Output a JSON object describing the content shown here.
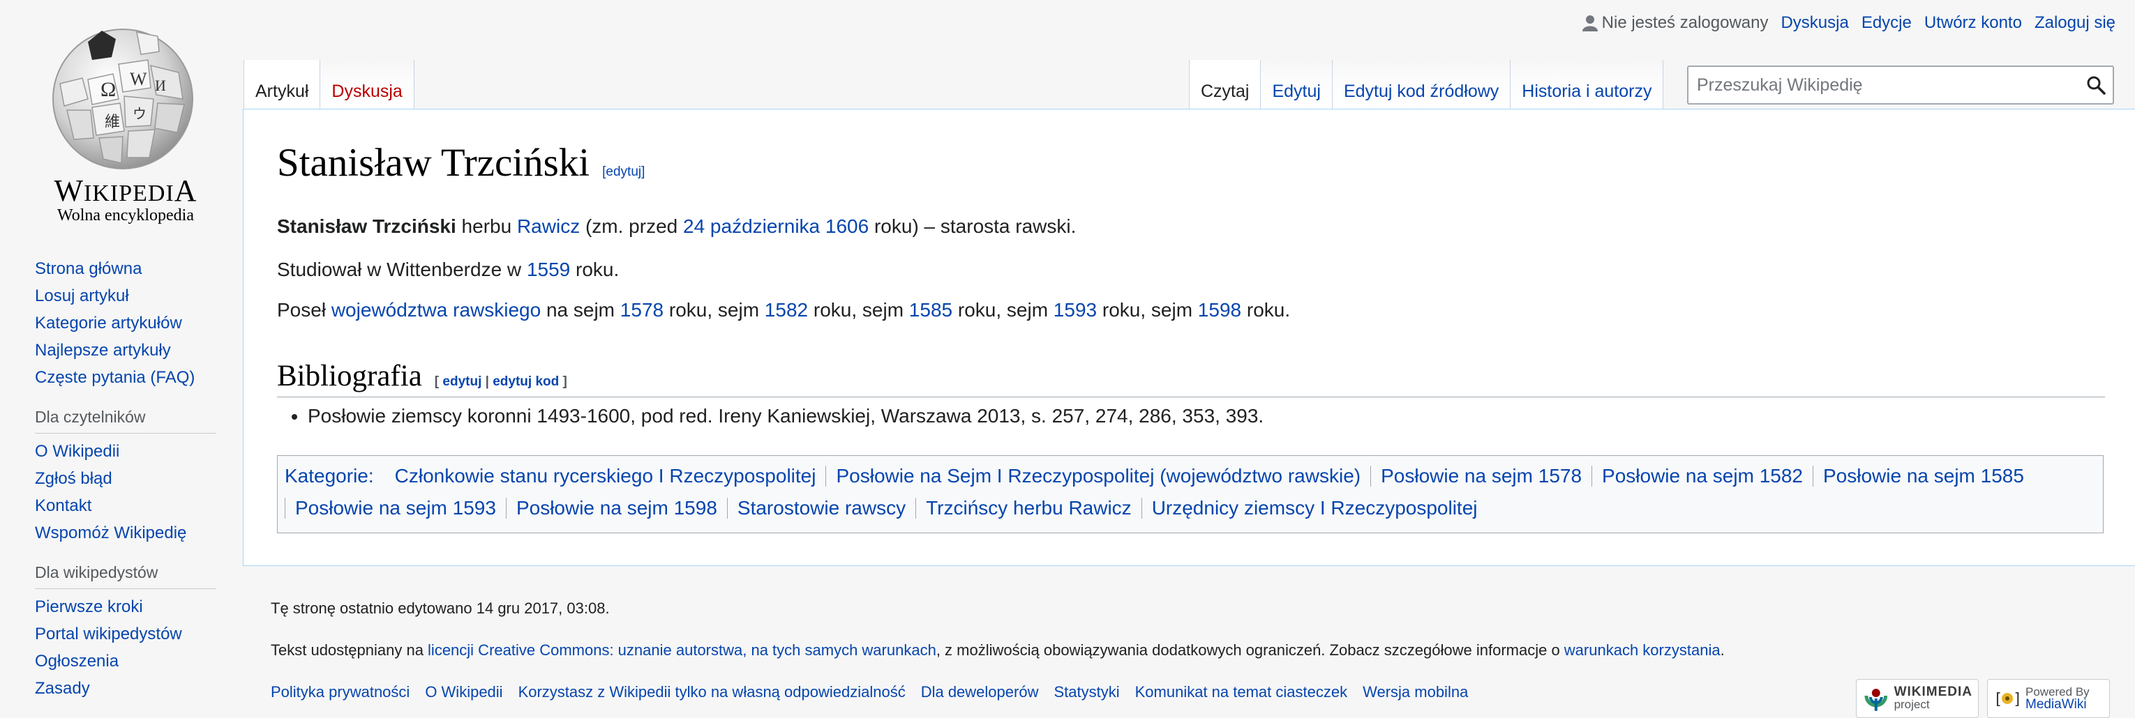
{
  "personal": {
    "anon": "Nie jesteś zalogowany",
    "talk": "Dyskusja",
    "contribs": "Edycje",
    "create": "Utwórz konto",
    "login": "Zaloguj się"
  },
  "logo": {
    "wordmark": "Wikipedia",
    "tagline": "Wolna encyklopedia"
  },
  "nav": {
    "main": [
      "Strona główna",
      "Losuj artykuł",
      "Kategorie artykułów",
      "Najlepsze artykuły",
      "Częste pytania (FAQ)"
    ],
    "readers": {
      "heading": "Dla czytelników",
      "items": [
        "O Wikipedii",
        "Zgłoś błąd",
        "Kontakt",
        "Wspomóż Wikipedię"
      ]
    },
    "editors": {
      "heading": "Dla wikipedystów",
      "items": [
        "Pierwsze kroki",
        "Portal wikipedystów",
        "Ogłoszenia",
        "Zasady"
      ]
    }
  },
  "tabs": {
    "left": [
      "Artykuł",
      "Dyskusja"
    ],
    "right": [
      "Czytaj",
      "Edytuj",
      "Edytuj kod źródłowy",
      "Historia i autorzy"
    ]
  },
  "search": {
    "placeholder": "Przeszukaj Wikipedię"
  },
  "article": {
    "title": "Stanisław Trzciński",
    "edit_label": "[edytuj]",
    "p1": {
      "bold": "Stanisław Trzciński",
      "t1": " herbu ",
      "l1": "Rawicz",
      "t2": " (zm. przed ",
      "l2": "24 października",
      "t3": " ",
      "l3": "1606",
      "t4": " roku) – starosta rawski."
    },
    "p2": {
      "t1": "Studiował w Wittenberdze w ",
      "l1": "1559",
      "t2": " roku."
    },
    "p3": {
      "t1": "Poseł ",
      "l1": "województwa rawskiego",
      "t2": " na sejm ",
      "l2": "1578",
      "t3": " roku, sejm ",
      "l3": "1582",
      "t4": " roku, sejm ",
      "l4": "1585",
      "t5": " roku, sejm ",
      "l5": "1593",
      "t6": " roku, sejm ",
      "l6": "1598",
      "t7": " roku."
    },
    "section": {
      "title": "Bibliografia",
      "bracket_open": "[ ",
      "edit": "edytuj",
      "sep": " | ",
      "edit_source": "edytuj kod",
      "bracket_close": " ]"
    },
    "bibliography": [
      "Posłowie ziemscy koronni 1493-1600, pod red. Ireny Kaniewskiej, Warszawa 2013, s. 257, 274, 286, 353, 393."
    ]
  },
  "categories": {
    "label": "Kategorie:",
    "row1": [
      "Członkowie stanu rycerskiego I Rzeczypospolitej",
      "Posłowie na Sejm I Rzeczypospolitej (województwo rawskie)",
      "Posłowie na sejm 1578",
      "Posłowie na sejm 1582",
      "Posłowie na sejm 1585"
    ],
    "row2": [
      "Posłowie na sejm 1593",
      "Posłowie na sejm 1598",
      "Starostowie rawscy",
      "Trzcińscy herbu Rawicz",
      "Urzędnicy ziemscy I Rzeczypospolitej"
    ]
  },
  "footer": {
    "last_modified": "Tę stronę ostatnio edytowano 14 gru 2017, 03:08.",
    "license": {
      "t1": "Tekst udostępniany na ",
      "l1": "licencji Creative Commons: uznanie autorstwa, na tych samych warunkach",
      "t2": ", z możliwością obowiązywania dodatkowych ograniczeń. Zobacz szczegółowe informacje o ",
      "l2": "warunkach korzystania",
      "t3": "."
    },
    "places": [
      "Polityka prywatności",
      "O Wikipedii",
      "Korzystasz z Wikipedii tylko na własną odpowiedzialność",
      "Dla deweloperów",
      "Statystyki",
      "Komunikat na temat ciasteczek",
      "Wersja mobilna"
    ],
    "badges": {
      "wikimedia": {
        "line1": "WIKIMEDIA",
        "line2": "project"
      },
      "mediawiki": {
        "line1": "Powered By",
        "line2": "MediaWiki"
      }
    }
  },
  "colors": {
    "link": "#0645ad",
    "new_link": "#ba0000",
    "content_border": "#a7d7f9",
    "page_bg": "#f6f6f6"
  }
}
